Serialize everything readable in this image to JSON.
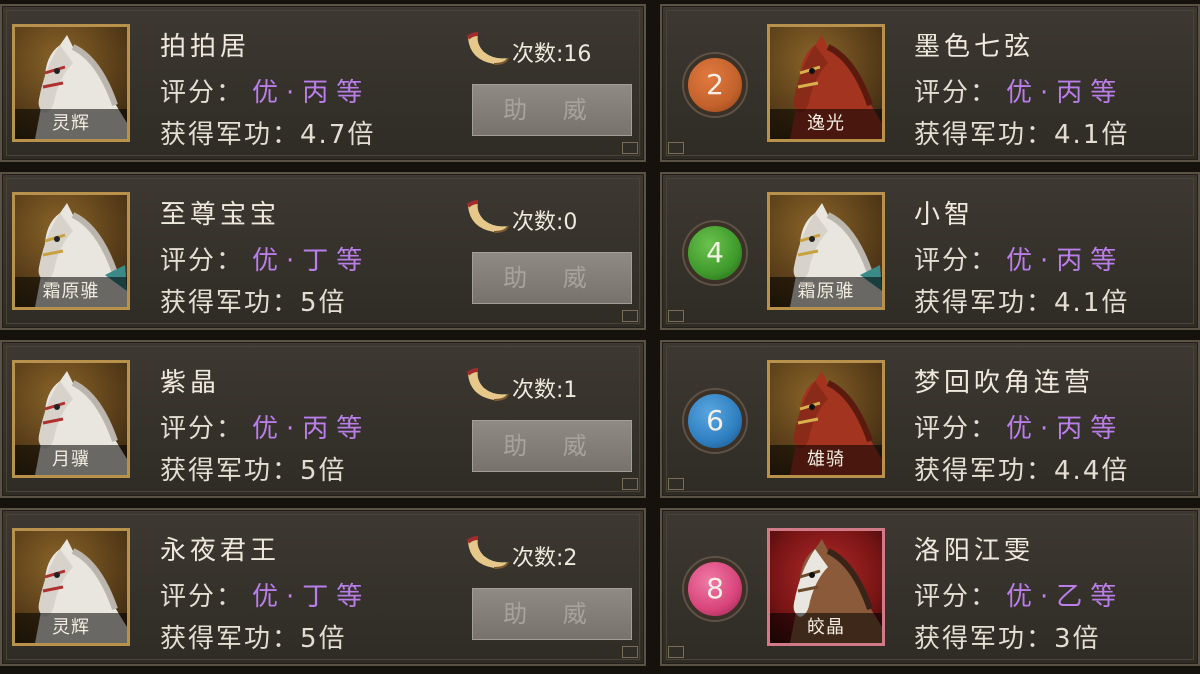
{
  "labels": {
    "rating_prefix": "评分：",
    "merit_prefix": "获得军功：",
    "count_prefix": "次数:",
    "cheer_button": "助 威"
  },
  "colors": {
    "rating_purple": "#b97ee8",
    "badge_orange": "#c4622c",
    "badge_green": "#3f9a2c",
    "badge_blue": "#2f7fc0",
    "badge_pink": "#d8457a",
    "portrait_gold_border": "#b8924c",
    "portrait_pink_border": "#cf7a86"
  },
  "left": [
    {
      "player": "拍拍居",
      "rating": "优·丙等",
      "merit": "4.7倍",
      "count": "16",
      "horse": "灵辉",
      "horse_color": "white"
    },
    {
      "player": "至尊宝宝",
      "rating": "优·丁等",
      "merit": "5倍",
      "count": "0",
      "horse": "霜原骓",
      "horse_color": "white"
    },
    {
      "player": "紫晶",
      "rating": "优·丙等",
      "merit": "5倍",
      "count": "1",
      "horse": "月骥",
      "horse_color": "white"
    },
    {
      "player": "永夜君王",
      "rating": "优·丁等",
      "merit": "5倍",
      "count": "2",
      "horse": "灵辉",
      "horse_color": "white"
    }
  ],
  "right": [
    {
      "rank": "2",
      "player": "墨色七弦",
      "rating": "优·丙等",
      "merit": "4.1倍",
      "horse": "逸光",
      "horse_color": "red",
      "badge_color": "#c4622c"
    },
    {
      "rank": "4",
      "player": "小智",
      "rating": "优·丙等",
      "merit": "4.1倍",
      "horse": "霜原骓",
      "horse_color": "white",
      "badge_color": "#3f9a2c"
    },
    {
      "rank": "6",
      "player": "梦回吹角连营",
      "rating": "优·丙等",
      "merit": "4.4倍",
      "horse": "雄骑",
      "horse_color": "red",
      "badge_color": "#2f7fc0"
    },
    {
      "rank": "8",
      "player": "洛阳江雯",
      "rating": "优·乙等",
      "merit": "3倍",
      "horse": "皎晶",
      "horse_color": "brown",
      "badge_color": "#d8457a"
    }
  ]
}
